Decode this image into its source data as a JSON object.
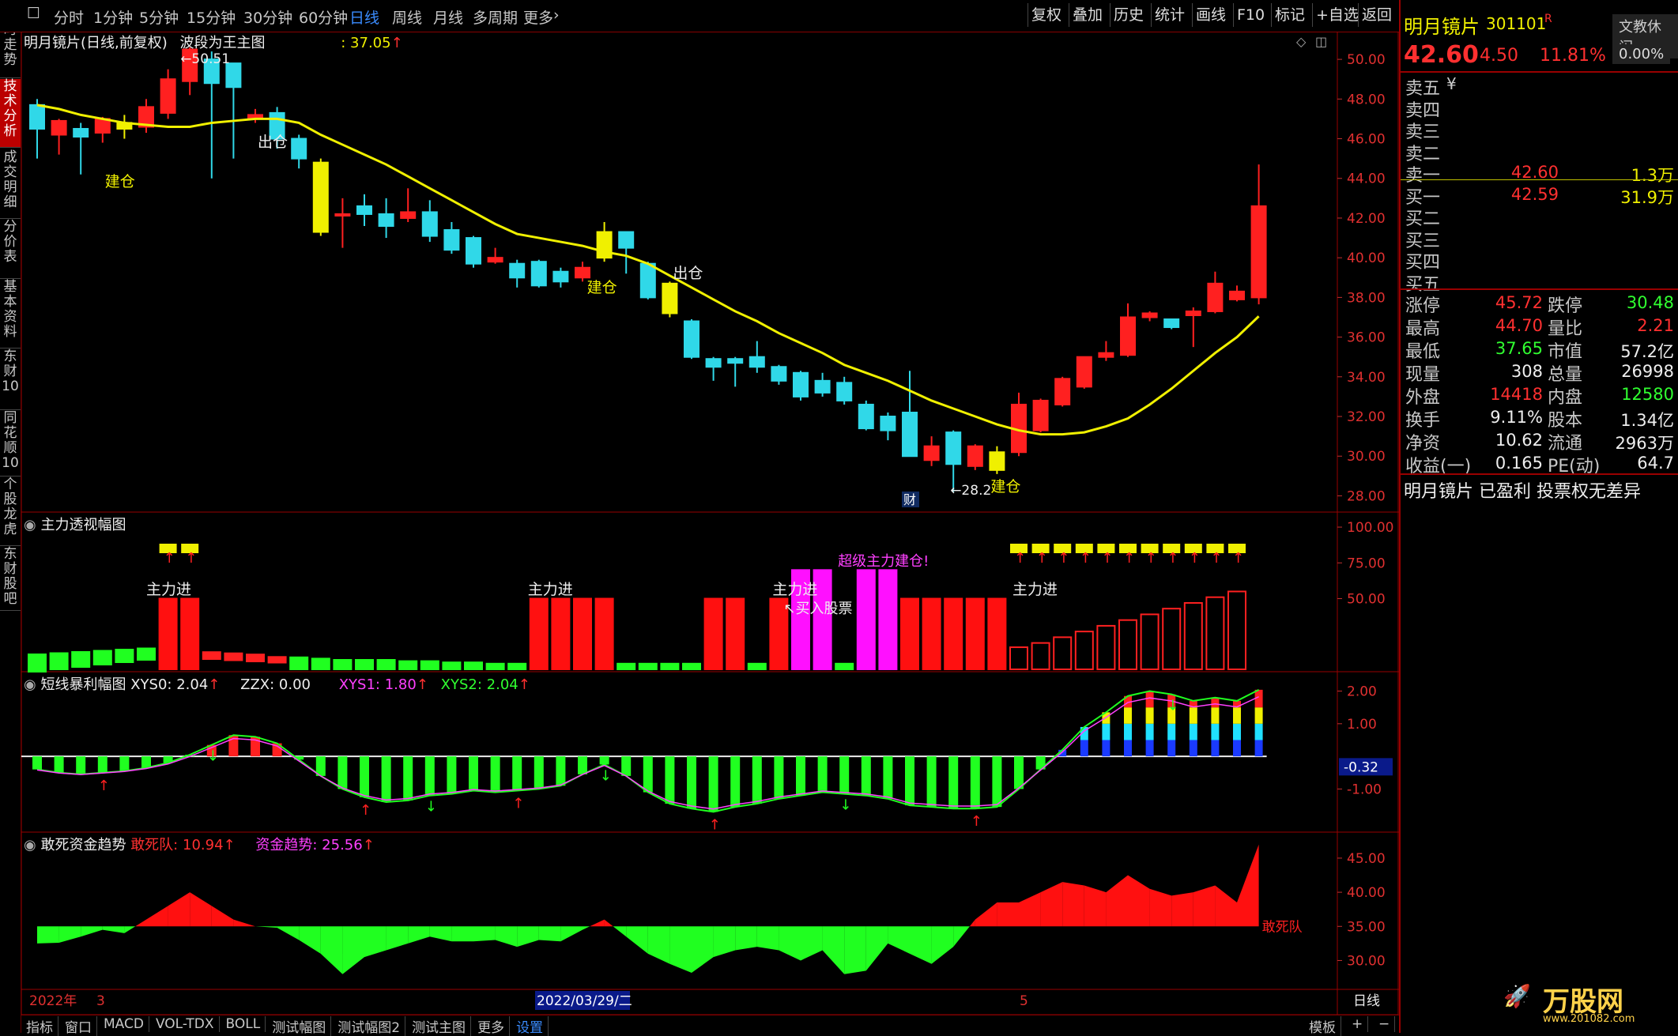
{
  "toolbar": {
    "periods": [
      "分时",
      "1分钟",
      "5分钟",
      "15分钟",
      "30分钟",
      "60分钟",
      "日线",
      "周线",
      "月线",
      "多周期",
      "更多"
    ],
    "active_period": "日线",
    "right_buttons": [
      "复权",
      "叠加",
      "历史",
      "统计",
      "画线",
      "F10",
      "标记",
      "+自选",
      "返回"
    ]
  },
  "left_tabs": [
    "分时走势",
    "技术分析",
    "成交明细",
    "分价表",
    "基本资料",
    "东财10",
    "同花顺10",
    "个股龙虎",
    "东财股吧"
  ],
  "active_left_tab": "技术分析",
  "main_chart": {
    "title": "明月镜片(日线,前复权)",
    "indicator": "波段为王主图",
    "indicator_value": ": 37.05",
    "y_ticks": [
      "50.00",
      "48.00",
      "46.00",
      "44.00",
      "42.00",
      "40.00",
      "38.00",
      "36.00",
      "34.00",
      "32.00",
      "30.00",
      "28.00"
    ],
    "high_marker": "50.51",
    "low_marker": "28.2",
    "annotations": {
      "jiancang": "建仓",
      "chucang": "出仓",
      "cai": "财"
    }
  },
  "pane2": {
    "title": "主力透视幅图",
    "y_ticks": [
      "100.00",
      "75.00",
      "50.00"
    ],
    "labels": {
      "zhulijin": "主力进",
      "super": "超级主力建仓!",
      "buy": "↖买入股票"
    }
  },
  "pane3": {
    "title": "短线暴利幅图",
    "xys0_label": "XYS0:",
    "xys0": "2.04",
    "zzx_label": "ZZX:",
    "zzx": "0.00",
    "xys1_label": "XYS1:",
    "xys1": "1.80",
    "xys2_label": "XYS2:",
    "xys2": "2.04",
    "y_ticks": [
      "2.00",
      "1.00",
      "-1.00"
    ],
    "cursor_value": "-0.32"
  },
  "pane4": {
    "title": "敢死资金趋势",
    "gsd_label": "敢死队:",
    "gsd": "10.94",
    "zjqs_label": "资金趋势:",
    "zjqs": "25.56",
    "y_ticks": [
      "45.00",
      "40.00",
      "35.00",
      "30.00"
    ],
    "series_tag": "敢死队"
  },
  "x_axis": {
    "year": "2022年",
    "m3": "3",
    "cursor_date": "2022/03/29/二",
    "m5": "5",
    "period": "日线"
  },
  "bottom_tabs": [
    "指标",
    "窗口",
    "MACD",
    "VOL-TDX",
    "BOLL",
    "测试幅图",
    "测试幅图2",
    "测试主图",
    "更多",
    "设置"
  ],
  "bottom_right": [
    "模板",
    "+",
    "−"
  ],
  "stock": {
    "name": "明月镜片",
    "code": "301101",
    "flag": "R",
    "badge": "文教休闲",
    "price": "42.60",
    "change": "4.50",
    "pct": "11.81%",
    "badge_pct": "0.00%"
  },
  "order_book": {
    "sell": [
      {
        "label": "卖五",
        "price": "",
        "vol": "",
        "note": "¥"
      },
      {
        "label": "卖四",
        "price": "",
        "vol": ""
      },
      {
        "label": "卖三",
        "price": "",
        "vol": ""
      },
      {
        "label": "卖二",
        "price": "",
        "vol": ""
      },
      {
        "label": "卖一",
        "price": "42.60",
        "vol": "1.3万"
      }
    ],
    "buy": [
      {
        "label": "买一",
        "price": "42.59",
        "vol": "31.9万"
      },
      {
        "label": "买二",
        "price": "",
        "vol": ""
      },
      {
        "label": "买三",
        "price": "",
        "vol": ""
      },
      {
        "label": "买四",
        "price": "",
        "vol": ""
      },
      {
        "label": "买五",
        "price": "",
        "vol": ""
      }
    ]
  },
  "quote": [
    {
      "l1": "涨停",
      "v1": "45.72",
      "c1": "red",
      "l2": "跌停",
      "v2": "30.48",
      "c2": "green"
    },
    {
      "l1": "最高",
      "v1": "44.70",
      "c1": "red",
      "l2": "量比",
      "v2": "2.21",
      "c2": "red"
    },
    {
      "l1": "最低",
      "v1": "37.65",
      "c1": "green",
      "l2": "市值",
      "v2": "57.2亿",
      "c2": "white"
    },
    {
      "l1": "现量",
      "v1": "308",
      "c1": "white",
      "l2": "总量",
      "v2": "26998",
      "c2": "white"
    },
    {
      "l1": "外盘",
      "v1": "14418",
      "c1": "red",
      "l2": "内盘",
      "v2": "12580",
      "c2": "green"
    },
    {
      "l1": "换手",
      "v1": "9.11%",
      "c1": "white",
      "l2": "股本",
      "v2": "1.34亿",
      "c2": "white"
    },
    {
      "l1": "净资",
      "v1": "10.62",
      "c1": "white",
      "l2": "流通",
      "v2": "2963万",
      "c2": "white"
    },
    {
      "l1": "收益(一)",
      "v1": "0.165",
      "c1": "white",
      "l2": "PE(动)",
      "v2": "64.7",
      "c2": "white"
    }
  ],
  "news_line": "明月镜片 已盈利 投票权无差异",
  "watermark": {
    "brand": "万股网",
    "url": "www.201082.com"
  },
  "chart_data": {
    "type": "candlestick",
    "candles": [
      [
        47.7,
        46.5,
        48.0,
        45.0
      ],
      [
        46.2,
        46.9,
        47.0,
        45.2
      ],
      [
        46.5,
        46.1,
        46.8,
        44.2
      ],
      [
        46.3,
        47.0,
        47.1,
        45.8
      ],
      [
        46.5,
        46.8,
        47.2,
        46.0
      ],
      [
        46.6,
        47.6,
        48.0,
        46.3
      ],
      [
        47.3,
        49.0,
        49.5,
        47.0
      ],
      [
        48.9,
        50.5,
        50.6,
        48.2
      ],
      [
        50.0,
        48.8,
        50.4,
        44.0
      ],
      [
        49.8,
        48.6,
        49.5,
        45.0
      ],
      [
        47.0,
        47.2,
        47.5,
        46.8
      ],
      [
        47.3,
        46.0,
        47.6,
        45.5
      ],
      [
        46.0,
        45.0,
        46.2,
        44.5
      ],
      [
        44.8,
        41.3,
        45.0,
        41.1
      ],
      [
        42.2,
        42.2,
        43.0,
        40.5
      ],
      [
        42.6,
        42.2,
        43.2,
        41.6
      ],
      [
        42.2,
        41.6,
        43.0,
        41.0
      ],
      [
        42.0,
        42.3,
        43.5,
        41.8
      ],
      [
        42.3,
        41.1,
        42.9,
        40.8
      ],
      [
        41.4,
        40.4,
        41.8,
        40.2
      ],
      [
        41.0,
        39.7,
        41.1,
        39.5
      ],
      [
        39.8,
        40.0,
        40.5,
        39.7
      ],
      [
        39.7,
        39.0,
        39.9,
        38.5
      ],
      [
        39.8,
        38.6,
        39.9,
        38.5
      ],
      [
        39.3,
        38.8,
        39.5,
        38.5
      ],
      [
        39.0,
        39.5,
        39.8,
        38.8
      ],
      [
        40.0,
        41.3,
        41.8,
        39.8
      ],
      [
        41.3,
        40.5,
        41.3,
        39.2
      ],
      [
        39.7,
        38.0,
        39.8,
        37.9
      ],
      [
        37.2,
        38.7,
        38.8,
        37.0
      ],
      [
        36.8,
        35.0,
        36.9,
        34.9
      ],
      [
        34.9,
        34.5,
        35.0,
        33.8
      ],
      [
        34.9,
        34.7,
        35.0,
        33.5
      ],
      [
        35.0,
        34.5,
        35.8,
        34.2
      ],
      [
        34.5,
        33.8,
        34.6,
        33.6
      ],
      [
        34.2,
        33.0,
        34.3,
        32.8
      ],
      [
        33.8,
        33.2,
        34.2,
        33.0
      ],
      [
        33.7,
        32.8,
        34.0,
        32.6
      ],
      [
        32.6,
        31.4,
        32.8,
        31.3
      ],
      [
        32.0,
        31.3,
        32.2,
        30.8
      ],
      [
        32.2,
        30.0,
        34.3,
        30.0
      ],
      [
        29.8,
        30.5,
        31.0,
        29.5
      ],
      [
        31.2,
        29.6,
        31.3,
        28.2
      ],
      [
        29.5,
        30.5,
        30.6,
        29.3
      ],
      [
        29.3,
        30.2,
        30.5,
        29.1
      ],
      [
        30.2,
        32.6,
        33.2,
        30.0
      ],
      [
        31.3,
        32.8,
        32.9,
        31.2
      ],
      [
        32.6,
        33.9,
        34.0,
        32.5
      ],
      [
        33.5,
        35.0,
        35.0,
        33.4
      ],
      [
        35.0,
        35.2,
        35.8,
        34.8
      ],
      [
        35.1,
        37.0,
        37.7,
        35.0
      ],
      [
        37.0,
        37.2,
        37.3,
        36.8
      ],
      [
        36.9,
        36.5,
        36.9,
        36.4
      ],
      [
        37.1,
        37.3,
        37.5,
        35.5
      ],
      [
        37.3,
        38.7,
        39.3,
        37.2
      ],
      [
        37.9,
        38.3,
        38.6,
        37.8
      ],
      [
        38.0,
        42.6,
        44.7,
        37.65
      ]
    ],
    "ma": [
      47.7,
      47.5,
      47.2,
      47.0,
      46.8,
      46.7,
      46.6,
      46.6,
      46.8,
      46.9,
      47.0,
      47.0,
      46.8,
      46.2,
      45.7,
      45.2,
      44.7,
      44.1,
      43.5,
      42.9,
      42.3,
      41.7,
      41.2,
      41.0,
      40.8,
      40.6,
      40.3,
      40.1,
      39.7,
      39.1,
      38.5,
      37.9,
      37.3,
      36.8,
      36.2,
      35.7,
      35.2,
      34.6,
      34.2,
      33.8,
      33.3,
      32.8,
      32.4,
      32.0,
      31.6,
      31.3,
      31.1,
      31.1,
      31.2,
      31.5,
      31.9,
      32.6,
      33.4,
      34.3,
      35.2,
      36.0,
      37.05
    ],
    "pane2_bars": [
      12,
      11,
      10,
      9,
      8,
      7,
      50,
      50,
      3,
      3,
      3,
      2,
      7,
      6,
      5,
      5,
      5,
      4,
      4,
      3,
      3,
      2,
      2,
      50,
      50,
      50,
      50,
      2,
      2,
      2,
      2,
      50,
      50,
      2,
      50,
      70,
      70,
      2,
      70,
      70,
      50,
      50,
      50,
      50,
      50,
      16,
      19,
      23,
      27,
      31,
      35,
      39,
      43,
      47,
      51,
      55
    ],
    "pane3_values": [
      -0.4,
      -0.5,
      -0.55,
      -0.5,
      -0.45,
      -0.35,
      -0.2,
      0.05,
      0.35,
      0.65,
      0.6,
      0.4,
      -0.1,
      -0.6,
      -1.0,
      -1.25,
      -1.4,
      -1.35,
      -1.2,
      -1.15,
      -1.05,
      -1.1,
      -1.05,
      -1.0,
      -0.9,
      -0.55,
      -0.25,
      -0.6,
      -1.1,
      -1.45,
      -1.6,
      -1.7,
      -1.55,
      -1.45,
      -1.3,
      -1.2,
      -1.1,
      -1.15,
      -1.2,
      -1.3,
      -1.5,
      -1.55,
      -1.6,
      -1.6,
      -1.55,
      -1.0,
      -0.4,
      0.2,
      0.9,
      1.35,
      1.85,
      2.0,
      1.9,
      1.7,
      1.8,
      1.7,
      2.04
    ],
    "pane4_values": [
      32.5,
      32.6,
      33.5,
      34.5,
      34.0,
      36.0,
      38.0,
      40.0,
      38.0,
      36.0,
      35.0,
      34.8,
      33.0,
      31.0,
      28.0,
      30.5,
      31.5,
      32.5,
      33.5,
      32.8,
      32.8,
      33.0,
      32.0,
      33.0,
      32.8,
      34.5,
      36.0,
      33.5,
      31.0,
      29.5,
      28.2,
      30.5,
      31.5,
      32.0,
      31.5,
      30.0,
      31.5,
      28.0,
      28.5,
      32.5,
      31.0,
      29.5,
      32.0,
      36.0,
      38.5,
      38.5,
      40.0,
      41.5,
      41.0,
      40.0,
      42.5,
      40.5,
      39.5,
      40.0,
      41.0,
      38.5,
      47.0
    ]
  }
}
